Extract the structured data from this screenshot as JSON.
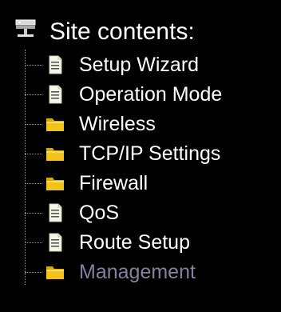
{
  "colors": {
    "background": "#000000",
    "text": "#ffffff",
    "dimmed_text": "#8282a0",
    "tree_lines": "#9a9a9a",
    "folder": "#f2c419",
    "page": "#f6f6e8"
  },
  "header": {
    "title": "Site contents:",
    "icon": "network-tree-icon"
  },
  "items": [
    {
      "label": "Setup Wizard",
      "icon": "page-icon"
    },
    {
      "label": "Operation Mode",
      "icon": "page-icon"
    },
    {
      "label": "Wireless",
      "icon": "folder-icon"
    },
    {
      "label": "TCP/IP Settings",
      "icon": "folder-icon"
    },
    {
      "label": "Firewall",
      "icon": "folder-icon"
    },
    {
      "label": "QoS",
      "icon": "page-icon"
    },
    {
      "label": "Route Setup",
      "icon": "page-icon"
    },
    {
      "label": "Management",
      "icon": "folder-icon",
      "dimmed": true
    }
  ]
}
